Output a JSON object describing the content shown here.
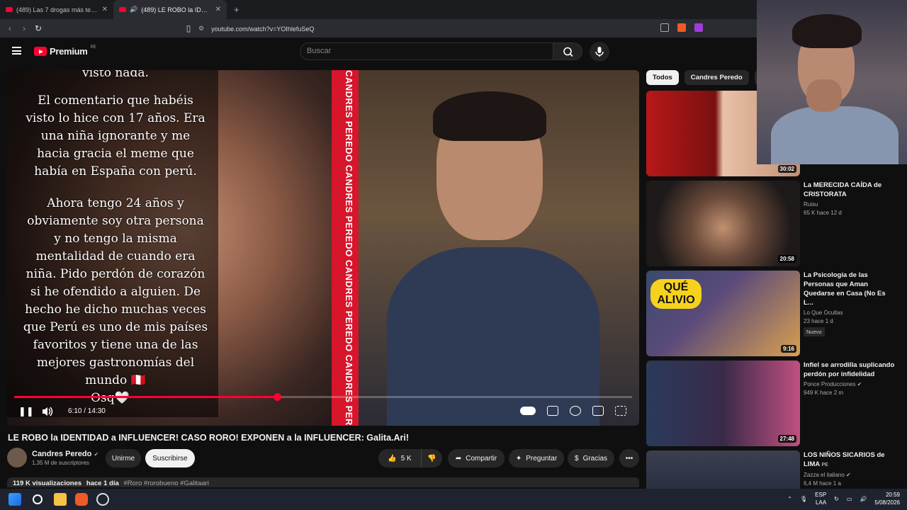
{
  "browser": {
    "tabs": [
      {
        "title": "(489) Las 7 drogas más terroríficas de",
        "active": false
      },
      {
        "title": "(489) LE ROBO la IDENTIDAD",
        "active": true
      }
    ],
    "url": "youtube.com/watch?v=YOIhlefuSeQ"
  },
  "header": {
    "logo_text": "Premium",
    "country": "PE",
    "search_placeholder": "Buscar"
  },
  "video": {
    "story_lines": [
      "visto nada.",
      "El comentario que habéis",
      "visto lo hice con 17 años. Era",
      "una niña ignorante y me",
      "hacia gracia el meme que",
      "había en España con perú.",
      "Ahora tengo 24 años y",
      "obviamente soy otra persona",
      "y no tengo la misma",
      "mentalidad de cuando era",
      "niña. Pido perdón de corazón",
      "si he ofendido a alguien. De",
      "hecho he dicho muchas veces",
      "que Perú es uno de mis países",
      "favoritos y tiene una de las",
      "mejores gastronomías del",
      "mundo 🇵🇪",
      "Osq🤍"
    ],
    "strip_text": "CANDRES PEREDO CANDRES PEREDO CANDRES PEREDO CANDRES PEREDO CANDRES PEREDO",
    "time": "6:10 / 14:30",
    "progress": 0.4253,
    "title": "LE ROBO la IDENTIDAD a INFLUENCER! CASO RORO! EXPONEN a la INFLUENCER: Galita.Ari!"
  },
  "channel": {
    "name": "Candres Peredo",
    "verified": "✔",
    "subscribers": "1,35 M de suscriptores",
    "join_label": "Unirme",
    "subscribe_label": "Suscribirse"
  },
  "actions": {
    "likes": "5 K",
    "share": "Compartir",
    "ask": "Preguntar",
    "thanks": "Gracias"
  },
  "description": {
    "views": "119 K visualizaciones",
    "age": "hace 1 día",
    "tags": "#Roro #rorobueno #Galitaari"
  },
  "chips": [
    "Todos",
    "Candres Peredo",
    "Re"
  ],
  "recommendations": [
    {
      "title": "",
      "channel": "",
      "meta": "",
      "duration": "30:02",
      "badge": "",
      "colors": [
        "#b81818",
        "#e8c2a8"
      ]
    },
    {
      "title": "La MERECIDA CAÍDA de CRISTORATA",
      "channel": "Ruisu",
      "meta": "65 K hace 12 d",
      "duration": "20:58",
      "badge": "",
      "colors": [
        "#2a2522",
        "#a07050"
      ]
    },
    {
      "title": "La Psicología de las Personas que Aman Quedarse en Casa (No Es L...",
      "channel": "Lo Que Ocultas",
      "meta": "23 hace 1 d",
      "duration": "9:16",
      "badge": "Nuevo",
      "colors": [
        "#5a4a7a",
        "#d9a050"
      ]
    },
    {
      "title": "Infiel se arrodilla suplicando perdón por infidelidad",
      "channel": "Ponce Producciones",
      "meta": "949 K hace 2 m",
      "duration": "27:48",
      "badge": "",
      "colors": [
        "#3a2a4a",
        "#c05080"
      ]
    },
    {
      "title": "LOS NIÑOS SICARIOS de LIMA",
      "channel": "Zazza el italiano",
      "meta": "6,4 M hace 1 a",
      "duration": "",
      "badge": "",
      "colors": [
        "#2a3040",
        "#6a7080"
      ]
    }
  ],
  "thumbnail_texts": {
    "rec3": "QUÉ ALIVIO"
  },
  "tray": {
    "lang": "ESP",
    "lang2": "LAA",
    "time": "20:59",
    "date": "5/08/2026"
  }
}
